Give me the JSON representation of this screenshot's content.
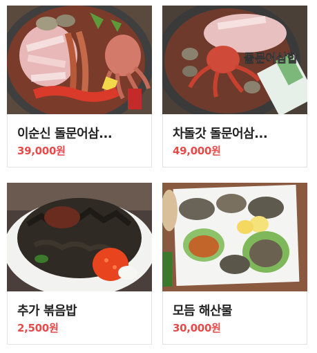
{
  "menu": {
    "items": [
      {
        "name": "이순신 돌문어삼...",
        "price": "39,000원"
      },
      {
        "name": "차돌갓 돌문어삼...",
        "price": "49,000원"
      },
      {
        "name": "추가 볶음밥",
        "price": "2,500원"
      },
      {
        "name": "모듬 해산물",
        "price": "30,000원"
      }
    ],
    "photo_overlay_text": "돌문어삼합"
  },
  "colors": {
    "price": "#e84a4a",
    "name": "#222222",
    "border": "#e3e3e3"
  }
}
